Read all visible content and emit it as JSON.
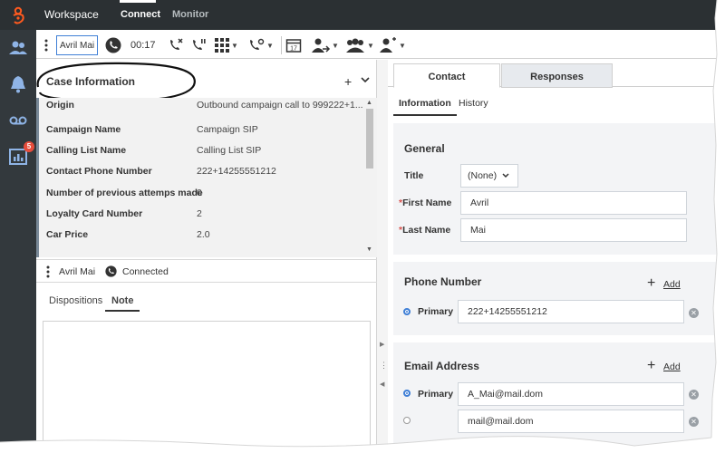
{
  "topbar": {
    "app_title": "Workspace",
    "nav": [
      {
        "label": "Connect",
        "active": true
      },
      {
        "label": "Monitor",
        "active": false
      }
    ]
  },
  "rail": {
    "items": [
      "contacts-icon",
      "notifications-icon",
      "voicemail-icon",
      "reports-icon"
    ],
    "badge_count": "5"
  },
  "toolbar": {
    "party_name": "Avril Mai",
    "timer": "00:17",
    "icons": [
      "end-call-icon",
      "hold-call-icon",
      "keypad-icon",
      "transfer-call-icon",
      "schedule-callback-icon",
      "instant-transfer-icon",
      "conference-icon",
      "consult-icon"
    ]
  },
  "case_info": {
    "title": "Case Information",
    "rows": [
      {
        "label": "Origin",
        "value": "Outbound campaign call to 999222+1..."
      },
      {
        "label": "Campaign Name",
        "value": "Campaign SIP"
      },
      {
        "label": "Calling List Name",
        "value": "Calling List SIP"
      },
      {
        "label": "Contact Phone Number",
        "value": "222+14255551212"
      },
      {
        "label": "Number of previous attemps made",
        "value": "0"
      },
      {
        "label": "Loyalty Card Number",
        "value": "2"
      },
      {
        "label": "Car Price",
        "value": "2.0"
      }
    ]
  },
  "party": {
    "name": "Avril Mai",
    "status": "Connected"
  },
  "disposition_tabs": [
    {
      "label": "Dispositions",
      "active": false
    },
    {
      "label": "Note",
      "active": true
    }
  ],
  "right": {
    "tabs": [
      {
        "label": "Contact",
        "active": true
      },
      {
        "label": "Responses",
        "active": false
      }
    ],
    "subtabs": [
      {
        "label": "Information",
        "active": true
      },
      {
        "label": "History",
        "active": false
      }
    ],
    "general": {
      "heading": "General",
      "title_label": "Title",
      "title_value": "(None)",
      "first_name_label": "First Name",
      "first_name_value": "Avril",
      "last_name_label": "Last Name",
      "last_name_value": "Mai"
    },
    "phone": {
      "heading": "Phone Number",
      "add_label": "Add",
      "entries": [
        {
          "label": "Primary",
          "value": "222+14255551212",
          "primary": true
        }
      ]
    },
    "email": {
      "heading": "Email Address",
      "add_label": "Add",
      "entries": [
        {
          "label": "Primary",
          "value": "A_Mai@mail.dom",
          "primary": true
        },
        {
          "label": "",
          "value": "mail@mail.dom",
          "primary": false
        }
      ]
    }
  },
  "colors": {
    "topbar": "#2b3033",
    "rail": "#33393d",
    "accent": "#3f7fd6",
    "brand_logo": "#ff5a1f",
    "badge": "#e74c3c"
  }
}
